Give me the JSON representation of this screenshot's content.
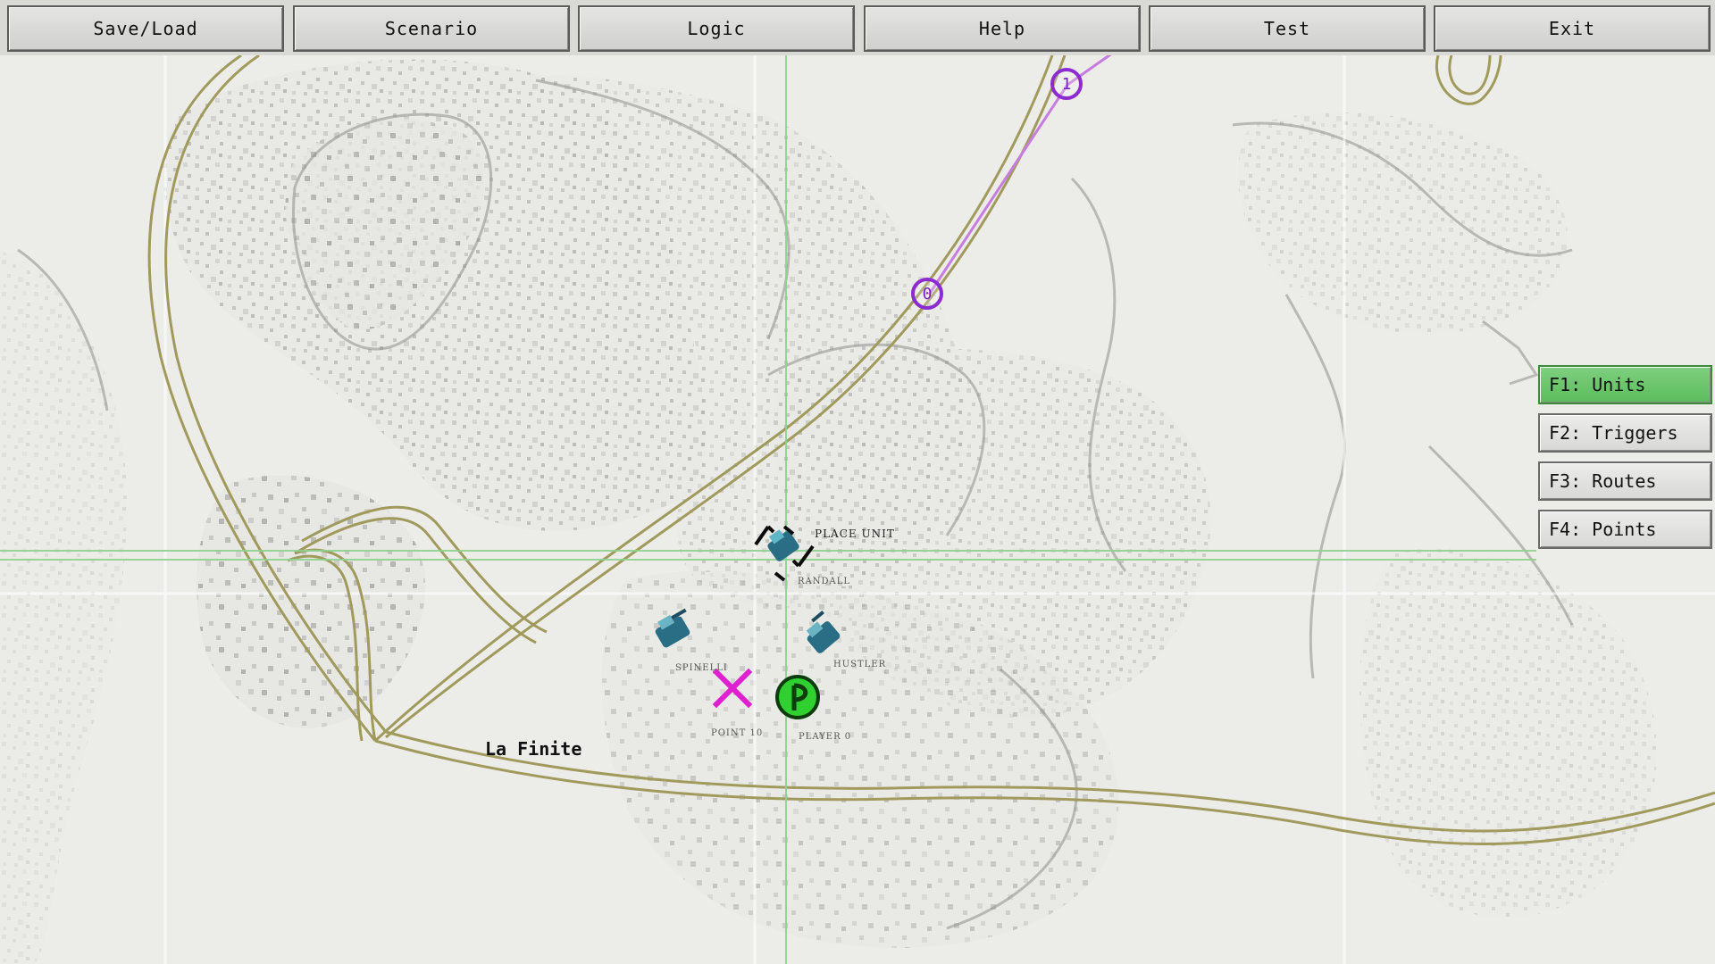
{
  "toolbar": {
    "save_load": "Save/Load",
    "scenario": "Scenario",
    "logic": "Logic",
    "help": "Help",
    "test": "Test",
    "exit": "Exit"
  },
  "side_panel": {
    "units": "F1: Units",
    "triggers": "F2: Triggers",
    "routes": "F3: Routes",
    "points": "F4: Points",
    "active": "units"
  },
  "map": {
    "town_name": "La Finite",
    "route_waypoints": [
      {
        "label": "0"
      },
      {
        "label": "1"
      }
    ],
    "cursor_label": "PLACE UNIT",
    "units": [
      {
        "name": "RANDALL",
        "icon": "tank-unit-icon"
      },
      {
        "name": "SPINELLI",
        "icon": "tank-unit-icon"
      },
      {
        "name": "HUSTLER",
        "icon": "tank-unit-icon"
      }
    ],
    "point_label": "POINT 10",
    "player_label": "PLAYER 0",
    "colors": {
      "road": "#a09a5c",
      "route": "#c77ce0",
      "waypoint": "#8c2bd0",
      "point_marker": "#e020d0",
      "player_marker": "#2fd02f",
      "grid": "#8ed28e",
      "unit": "#2a6e86"
    }
  }
}
